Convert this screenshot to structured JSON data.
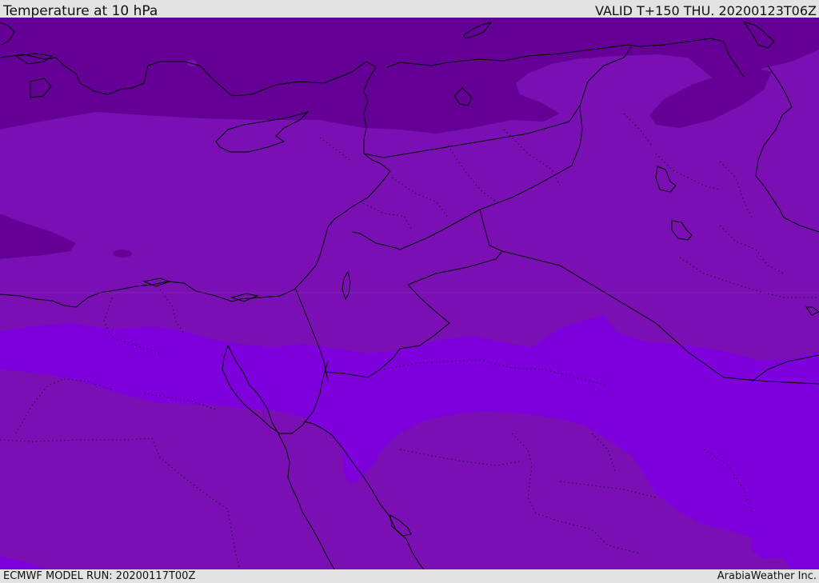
{
  "header": {
    "title": "Temperature at 10 hPa",
    "valid": "VALID T+150 THU. 20200123T06Z"
  },
  "footer": {
    "model_run": "ECMWF MODEL RUN: 20200117T00Z",
    "credit": "ArabiaWeather Inc."
  },
  "map": {
    "region": "Eastern Mediterranean and Middle East",
    "bands": [
      {
        "name": "darkest",
        "color": "#640096"
      },
      {
        "name": "mid",
        "color": "#7a10b4"
      },
      {
        "name": "bright",
        "color": "#7e00dc"
      }
    ],
    "coastline_color": "#000000",
    "border_style": "dotted"
  }
}
